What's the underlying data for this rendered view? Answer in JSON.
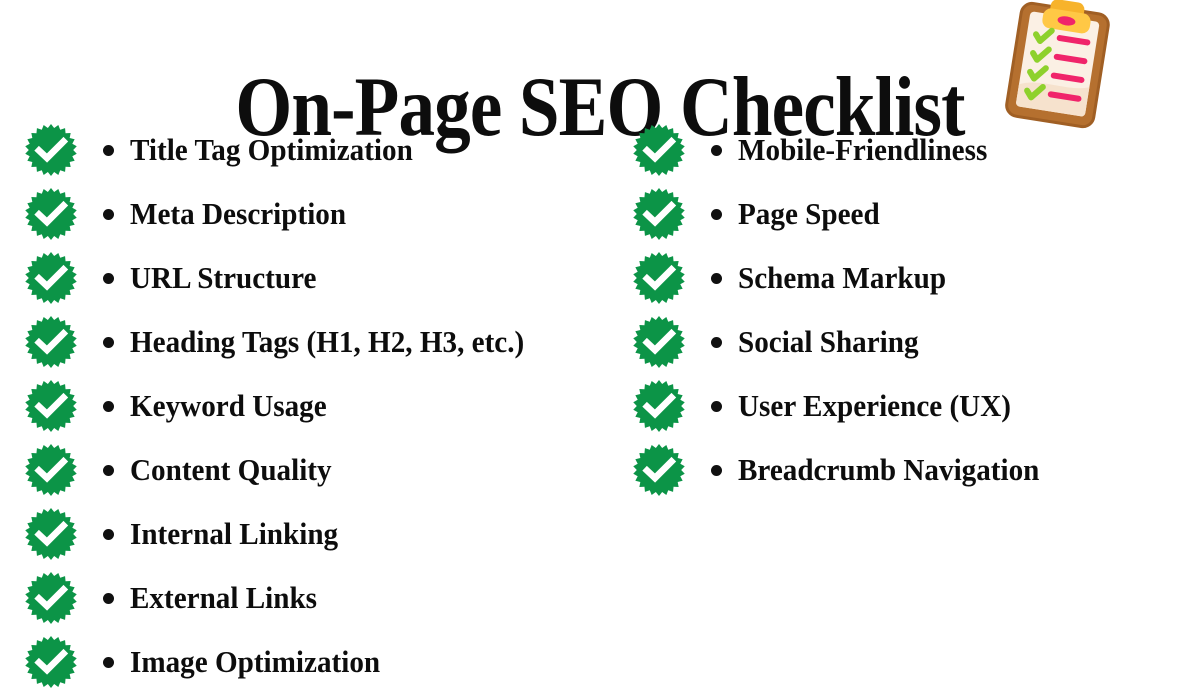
{
  "header": {
    "title": "On-Page SEO Checklist",
    "icon": "clipboard-icon"
  },
  "colors": {
    "badge_green": "#0c9447",
    "badge_check": "#ffffff",
    "text": "#0d0d0d",
    "background": "#ffffff",
    "clipboard_board": "#b5702f",
    "clipboard_clip": "#f7b32b",
    "clipboard_paper": "#fbf0e4",
    "clipboard_check": "#8ed12c",
    "clipboard_line": "#f0246a"
  },
  "checklist": {
    "badge_icon": "check-badge-icon",
    "bullet_icon": "bullet-dot-icon",
    "left_column": [
      {
        "label": "Title Tag Optimization",
        "checked": true
      },
      {
        "label": "Meta Description",
        "checked": true
      },
      {
        "label": "URL Structure",
        "checked": true
      },
      {
        "label": "Heading Tags (H1, H2, H3, etc.)",
        "checked": true
      },
      {
        "label": "Keyword Usage",
        "checked": true
      },
      {
        "label": "Content Quality",
        "checked": true
      },
      {
        "label": "Internal Linking",
        "checked": true
      },
      {
        "label": "External Links",
        "checked": true
      },
      {
        "label": "Image Optimization",
        "checked": true
      }
    ],
    "right_column": [
      {
        "label": "Mobile-Friendliness",
        "checked": true
      },
      {
        "label": "Page Speed",
        "checked": true
      },
      {
        "label": "Schema Markup",
        "checked": true
      },
      {
        "label": "Social Sharing",
        "checked": true
      },
      {
        "label": "User Experience (UX)",
        "checked": true
      },
      {
        "label": "Breadcrumb Navigation",
        "checked": true
      }
    ]
  }
}
